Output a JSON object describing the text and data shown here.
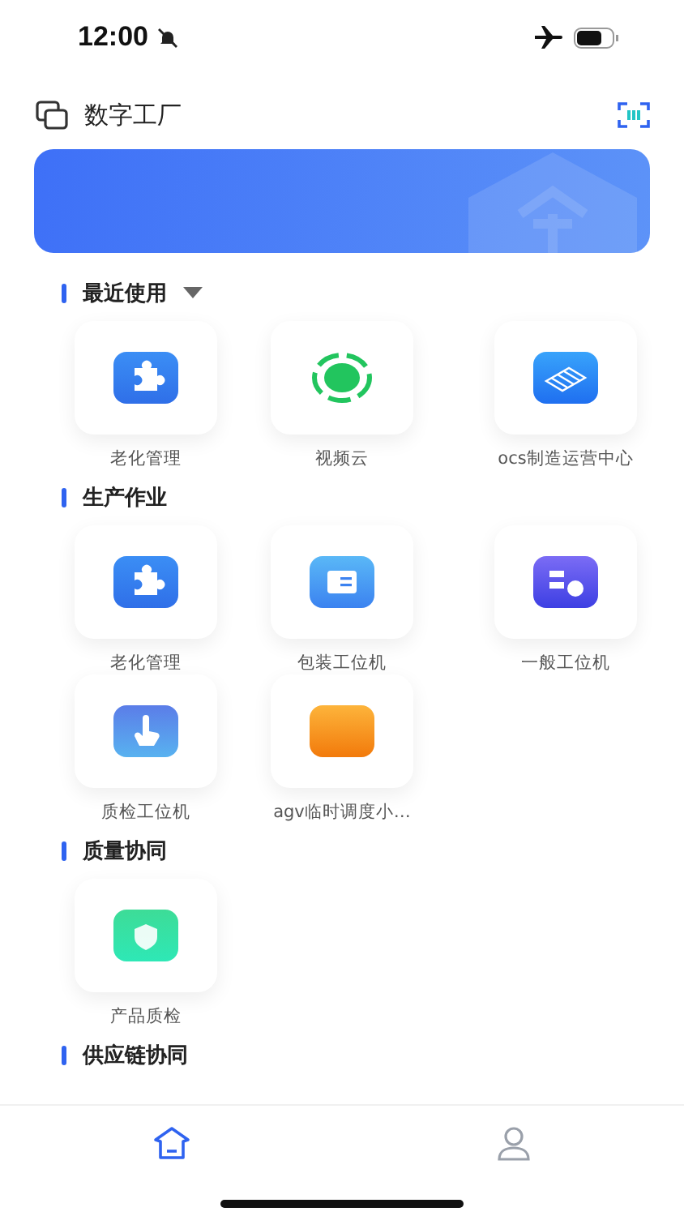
{
  "status_bar": {
    "time": "12:00",
    "silent": true,
    "airplane": true
  },
  "header": {
    "title": "数字工厂"
  },
  "sections": [
    {
      "title": "最近使用",
      "dropdown": true,
      "apps": [
        {
          "label": "老化管理",
          "kind": "puzzle"
        },
        {
          "label": "视频云",
          "kind": "ring"
        },
        {
          "label": "ocs制造运营中心",
          "kind": "conveyor"
        }
      ]
    },
    {
      "title": "生产作业",
      "dropdown": false,
      "apps": [
        {
          "label": "老化管理",
          "kind": "puzzle"
        },
        {
          "label": "包装工位机",
          "kind": "box"
        },
        {
          "label": "一般工位机",
          "kind": "flow"
        },
        {
          "label": "质检工位机",
          "kind": "hand"
        },
        {
          "label": "agv临时调度小…",
          "kind": "folder"
        }
      ]
    },
    {
      "title": "质量协同",
      "dropdown": false,
      "apps": [
        {
          "label": "产品质检",
          "kind": "shield"
        }
      ]
    },
    {
      "title": "供应链协同",
      "dropdown": false
    }
  ],
  "tab_bar": [
    {
      "kind": "home",
      "selected": true
    },
    {
      "kind": "profile",
      "selected": false
    }
  ]
}
